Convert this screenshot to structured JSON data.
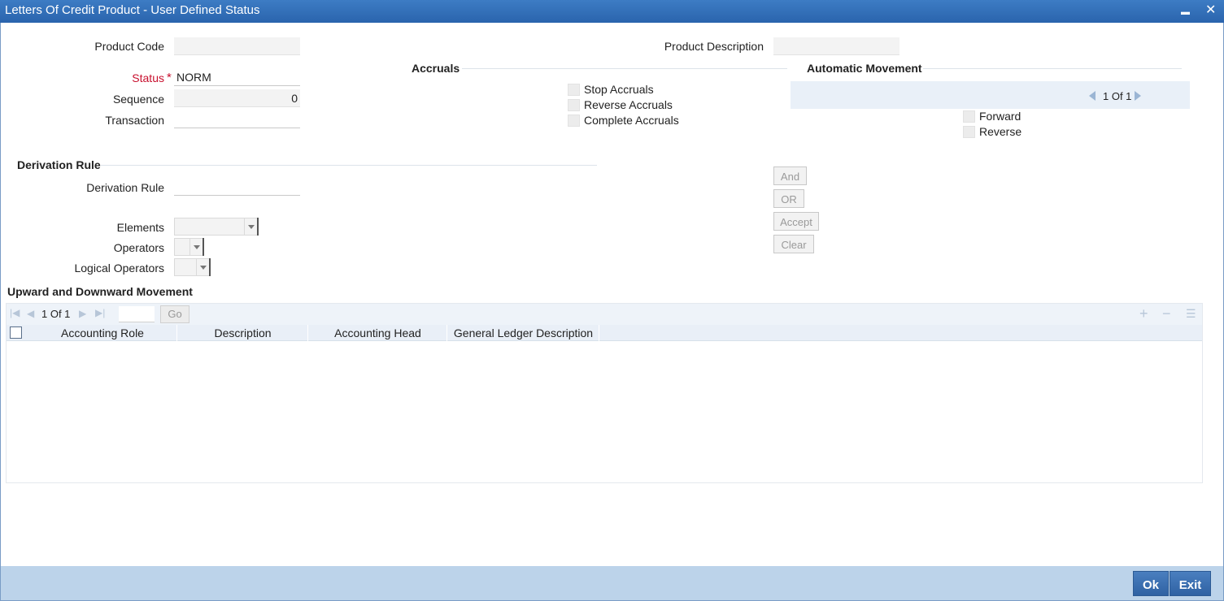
{
  "window": {
    "title": "Letters Of Credit Product - User Defined Status",
    "minimize": "▬",
    "close": "✕"
  },
  "form": {
    "product_code_label": "Product Code",
    "product_code_value": "",
    "product_description_label": "Product Description",
    "product_description_value": "",
    "status_label": "Status",
    "required_mark": "*",
    "status_value": "NORM",
    "sequence_label": "Sequence",
    "sequence_value": "0",
    "transaction_label": "Transaction",
    "transaction_value": ""
  },
  "accruals": {
    "heading": "Accruals",
    "options": [
      "Stop Accruals",
      "Reverse Accruals",
      "Complete Accruals"
    ]
  },
  "automatic_movement": {
    "heading": "Automatic Movement",
    "pager": "1 Of 1",
    "options": [
      "Forward",
      "Reverse"
    ]
  },
  "derivation": {
    "heading": "Derivation Rule",
    "rule_label": "Derivation Rule",
    "rule_value": "",
    "elements_label": "Elements",
    "operators_label": "Operators",
    "logical_operators_label": "Logical Operators",
    "buttons": [
      "And",
      "OR",
      "Accept",
      "Clear"
    ]
  },
  "movement_grid": {
    "heading": "Upward and Downward Movement",
    "pager": "1 Of 1",
    "go_label": "Go",
    "columns": [
      "Accounting Role",
      "Description",
      "Accounting Head",
      "General Ledger Description"
    ],
    "rows": [],
    "add_icon": "+",
    "remove_icon": "−",
    "view_icon": "☰"
  },
  "footer": {
    "ok_label": "Ok",
    "exit_label": "Exit"
  },
  "colors": {
    "titlebar": "#2f6db5",
    "footer": "#bcd3ea",
    "button": "#3b6fae",
    "required": "#c8102e"
  }
}
